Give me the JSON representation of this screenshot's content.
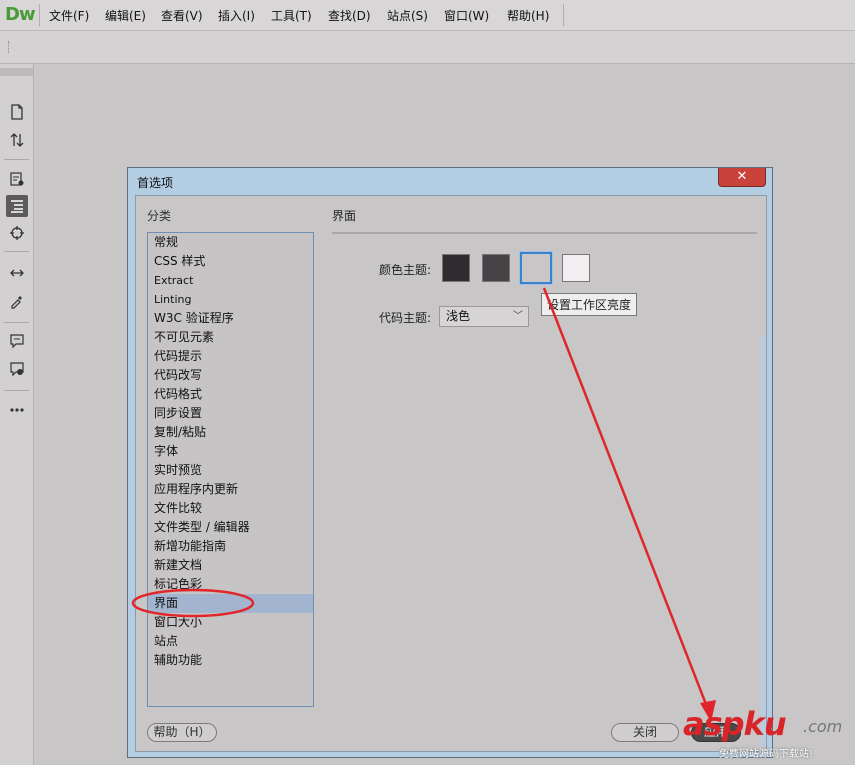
{
  "app": {
    "logo": "Dw"
  },
  "menu": [
    "文件(F)",
    "编辑(E)",
    "查看(V)",
    "插入(I)",
    "工具(T)",
    "查找(D)",
    "站点(S)",
    "窗口(W)",
    "帮助(H)"
  ],
  "dialog": {
    "title": "首选项",
    "close_icon": "✕",
    "category_label": "分类",
    "categories": [
      "常规",
      "CSS 样式",
      "Extract",
      "Linting",
      "W3C 验证程序",
      "不可见元素",
      "代码提示",
      "代码改写",
      "代码格式",
      "同步设置",
      "复制/粘贴",
      "字体",
      "实时预览",
      "应用程序内更新",
      "文件比较",
      "文件类型 / 编辑器",
      "新增功能指南",
      "新建文档",
      "标记色彩",
      "界面",
      "窗口大小",
      "站点",
      "辅助功能"
    ],
    "selected_category": "界面",
    "pane": {
      "title": "界面",
      "color_theme_label": "颜色主题:",
      "swatches": [
        "#2e2c30",
        "#454346",
        "#c8c6c6",
        "#f2eef2"
      ],
      "selected_swatch": 3,
      "tooltip": "设置工作区亮度",
      "code_theme_label": "代码主题:",
      "code_theme_value": "浅色"
    },
    "buttons": {
      "help": "帮助（H）",
      "close": "关闭",
      "apply": "应用"
    }
  },
  "annotation_color": "#e0262b",
  "watermark": {
    "main": "aspku",
    "com": ".com",
    "sub": "免费网站源码下载站!"
  }
}
